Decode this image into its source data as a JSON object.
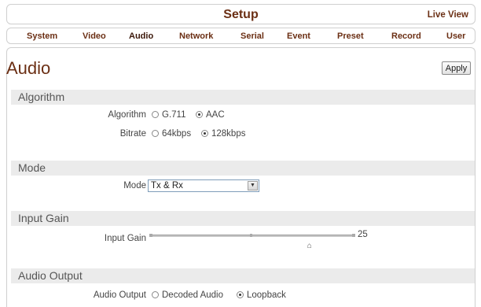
{
  "header": {
    "title": "Setup",
    "live_view": "Live View"
  },
  "nav": {
    "tabs": [
      "System",
      "Video",
      "Audio",
      "Network",
      "Serial",
      "Event",
      "Preset",
      "Record",
      "User"
    ],
    "active": "Audio"
  },
  "page": {
    "title": "Audio",
    "apply_label": "Apply"
  },
  "algorithm": {
    "section": "Algorithm",
    "algorithm_label": "Algorithm",
    "algorithm_options": [
      "G.711",
      "AAC"
    ],
    "algorithm_selected": "AAC",
    "bitrate_label": "Bitrate",
    "bitrate_options": [
      "64kbps",
      "128kbps"
    ],
    "bitrate_selected": "128kbps"
  },
  "mode": {
    "section": "Mode",
    "label": "Mode",
    "value": "Tx & Rx"
  },
  "input_gain": {
    "section": "Input Gain",
    "label": "Input Gain",
    "value": "25"
  },
  "audio_output": {
    "section": "Audio Output",
    "label": "Audio Output",
    "options": [
      "Decoded Audio",
      "Loopback"
    ],
    "selected": "Loopback"
  },
  "icons": {
    "select_arrow": "chevron-down-icon",
    "slider_thumb": "slider-thumb-icon"
  }
}
